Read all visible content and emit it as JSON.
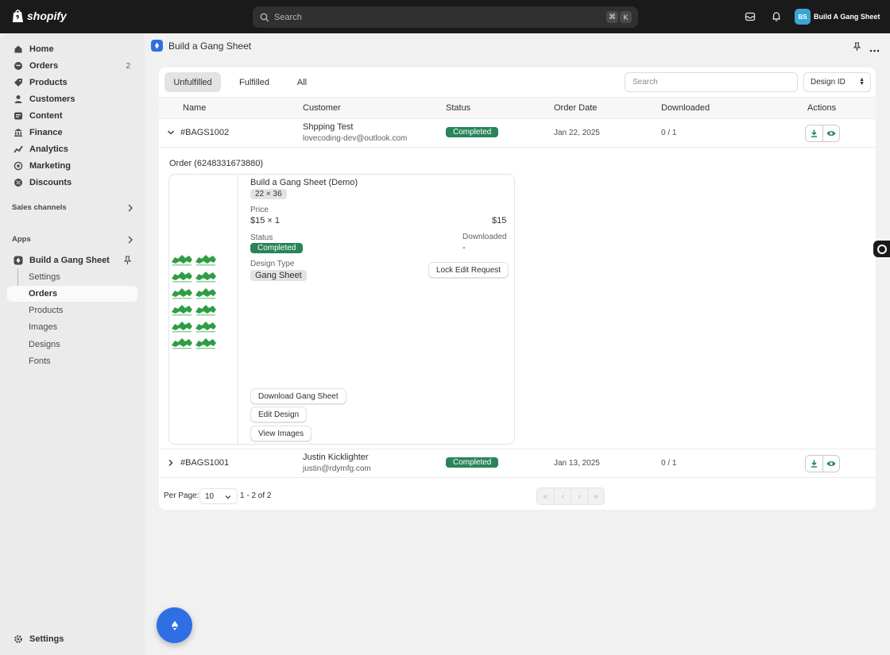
{
  "topbar": {
    "brand": "shopify",
    "search_placeholder": "Search",
    "shortcut_key1": "⌘",
    "shortcut_key2": "K",
    "store_initials": "BS",
    "store_name": "Build A Gang Sheet"
  },
  "sidebar": {
    "items": [
      {
        "label": "Home",
        "icon": "home-icon"
      },
      {
        "label": "Orders",
        "icon": "orders-icon",
        "badge": "2"
      },
      {
        "label": "Products",
        "icon": "tag-icon"
      },
      {
        "label": "Customers",
        "icon": "person-icon"
      },
      {
        "label": "Content",
        "icon": "content-icon"
      },
      {
        "label": "Finance",
        "icon": "bank-icon"
      },
      {
        "label": "Analytics",
        "icon": "analytics-icon"
      },
      {
        "label": "Marketing",
        "icon": "target-icon"
      },
      {
        "label": "Discounts",
        "icon": "discount-icon"
      }
    ],
    "sales_channels": "Sales channels",
    "apps": "Apps",
    "app_name": "Build a Gang Sheet",
    "app_sub_items": [
      "Settings",
      "Orders",
      "Products",
      "Images",
      "Designs",
      "Fonts"
    ],
    "active_sub_item": "Orders",
    "settings": "Settings"
  },
  "page": {
    "title": "Build a Gang Sheet"
  },
  "tabs": [
    "Unfulfilled",
    "Fulfilled",
    "All"
  ],
  "active_tab": "Unfulfilled",
  "filters": {
    "search_placeholder": "Search",
    "select_value": "Design ID"
  },
  "table": {
    "headers": [
      "Name",
      "Customer",
      "Status",
      "Order Date",
      "Downloaded",
      "Actions"
    ],
    "rows": [
      {
        "name": "#BAGS1002",
        "customer": "Shpping Test",
        "email": "lovecoding-dev@outlook.com",
        "status": "Completed",
        "date": "Jan 22, 2025",
        "downloaded": "0 / 1",
        "expanded": true
      },
      {
        "name": "#BAGS1001",
        "customer": "Justin Kicklighter",
        "email": "justin@rdymfg.com",
        "status": "Completed",
        "date": "Jan 13, 2025",
        "downloaded": "0 / 1",
        "expanded": false
      }
    ]
  },
  "detail": {
    "order_label": "Order (6248331673880)",
    "item_title": "Build a Gang Sheet (Demo)",
    "size": "22 × 36",
    "price_label": "Price",
    "price_value": "$15 × 1",
    "total": "$15",
    "status_label": "Status",
    "status_value": "Completed",
    "downloaded_label": "Downloaded",
    "downloaded_value": "-",
    "design_type_label": "Design Type",
    "design_type_value": "Gang Sheet",
    "lock_button": "Lock Edit Request",
    "download_button": "Download Gang Sheet",
    "edit_button": "Edit Design",
    "view_button": "View Images"
  },
  "pagination": {
    "per_page_label": "Per Page:",
    "per_page_value": "10",
    "range": "1 - 2 of 2"
  },
  "colors": {
    "accent": "#2f6fe4",
    "success": "#29845a",
    "topbar": "#1a1a1a"
  }
}
